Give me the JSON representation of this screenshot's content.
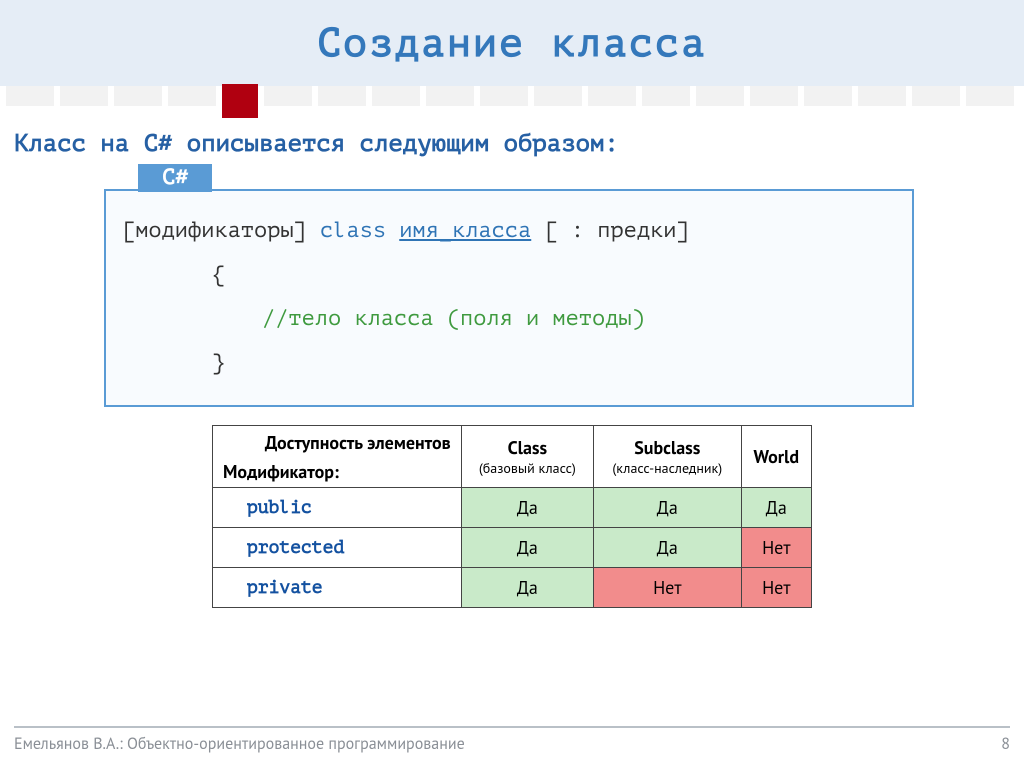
{
  "title": "Создание класса",
  "lead": "Класс на C# описывается следующим образом:",
  "code": {
    "tab": "C#",
    "line1_pre": "[модификаторы]  ",
    "line1_kw": "class",
    "line1_mid": "  ",
    "line1_name": "имя_класса",
    "line1_post": "  [ : предки]",
    "brace_open": "{",
    "comment": "//тело класса (поля и методы)",
    "brace_close": "}"
  },
  "table": {
    "corner_top": "Доступность элементов",
    "corner_bottom": "Модификатор:",
    "cols": [
      {
        "title": "Class",
        "sub": "(базовый класс)"
      },
      {
        "title": "Subclass",
        "sub": "(класс-наследник)"
      },
      {
        "title": "World",
        "sub": ""
      }
    ],
    "rows": [
      {
        "mod": "public",
        "cells": [
          "Да",
          "Да",
          "Да"
        ],
        "flags": [
          "yes",
          "yes",
          "yes"
        ]
      },
      {
        "mod": "protected",
        "cells": [
          "Да",
          "Да",
          "Нет"
        ],
        "flags": [
          "yes",
          "yes",
          "no"
        ]
      },
      {
        "mod": "private",
        "cells": [
          "Да",
          "Нет",
          "Нет"
        ],
        "flags": [
          "yes",
          "no",
          "no"
        ]
      }
    ]
  },
  "footer": {
    "author": "Емельянов В.А.: Объектно-ориентированное программирование",
    "page": "8"
  }
}
